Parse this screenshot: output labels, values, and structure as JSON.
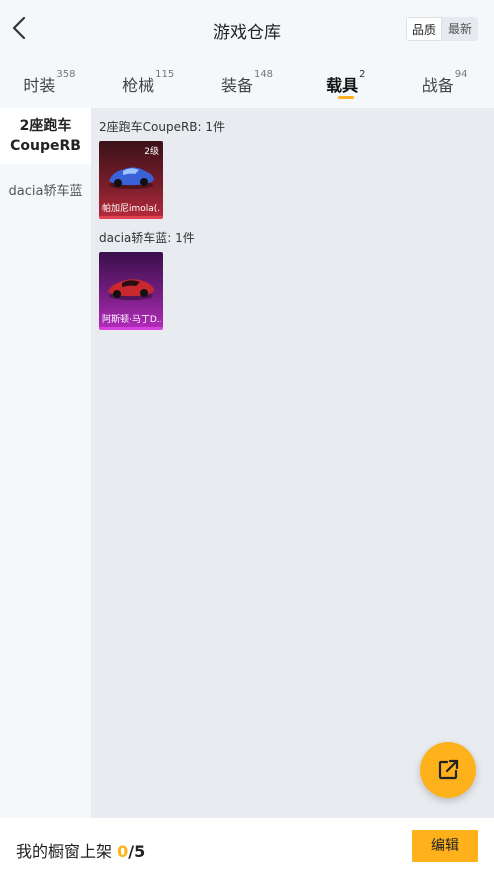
{
  "header": {
    "title": "游戏仓库",
    "sort_options": [
      "品质",
      "最新"
    ],
    "active_sort": "品质"
  },
  "tabs": [
    {
      "label": "时装",
      "count": "358",
      "active": false
    },
    {
      "label": "枪械",
      "count": "115",
      "active": false
    },
    {
      "label": "装备",
      "count": "148",
      "active": false
    },
    {
      "label": "载具",
      "count": "2",
      "active": true
    },
    {
      "label": "战备",
      "count": "94",
      "active": false
    }
  ],
  "sidebar": {
    "items": [
      {
        "label": "2座跑车CoupeRB",
        "active": true
      },
      {
        "label": "dacia轿车蓝",
        "active": false
      }
    ]
  },
  "groups": [
    {
      "title": "2座跑车CoupeRB: 1件",
      "items": [
        {
          "name": "帕加尼imola(...",
          "level": "2级",
          "rarity_color": "#e0424e"
        }
      ]
    },
    {
      "title": "dacia轿车蓝: 1件",
      "items": [
        {
          "name": "阿斯顿·马丁D...",
          "level": "",
          "rarity_color": "#d844e0"
        }
      ]
    }
  ],
  "footer": {
    "label": "我的橱窗上架",
    "count": "0",
    "total": "/5",
    "edit_label": "编辑"
  },
  "colors": {
    "accent": "#ffb11b",
    "content_bg": "#e8ebef"
  },
  "icons": {
    "back": "chevron-left-icon",
    "fab": "share-external-icon"
  }
}
